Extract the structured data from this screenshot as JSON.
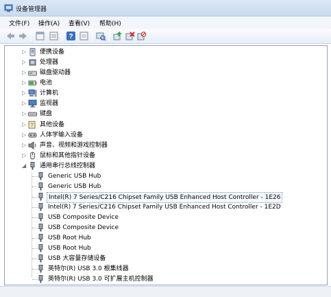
{
  "window": {
    "title": "设备管理器"
  },
  "menu": [
    {
      "label": "文件(F)"
    },
    {
      "label": "操作(A)"
    },
    {
      "label": "查看(V)"
    },
    {
      "label": "帮助(H)"
    }
  ],
  "toolbar": {
    "buttons": [
      {
        "icon": "back-arrow-icon"
      },
      {
        "icon": "forward-arrow-icon"
      },
      {
        "icon": "properties-icon"
      },
      {
        "icon": "show-hide-icon"
      },
      {
        "icon": "help-icon"
      },
      {
        "icon": "console-icon"
      },
      {
        "icon": "scan-hardware-icon"
      },
      {
        "icon": "update-driver-icon"
      },
      {
        "icon": "uninstall-icon"
      },
      {
        "icon": "disable-icon"
      }
    ]
  },
  "tree": {
    "categories": [
      {
        "label": "便携设备",
        "icon": "portable-device-icon",
        "expanded": false
      },
      {
        "label": "处理器",
        "icon": "processor-icon",
        "expanded": false
      },
      {
        "label": "磁盘驱动器",
        "icon": "disk-drive-icon",
        "expanded": false
      },
      {
        "label": "电池",
        "icon": "battery-icon",
        "expanded": false
      },
      {
        "label": "计算机",
        "icon": "computer-icon",
        "expanded": false
      },
      {
        "label": "监视器",
        "icon": "monitor-icon",
        "expanded": false
      },
      {
        "label": "键盘",
        "icon": "keyboard-icon",
        "expanded": false
      },
      {
        "label": "其他设备",
        "icon": "other-devices-icon",
        "expanded": false
      },
      {
        "label": "人体学输入设备",
        "icon": "hid-icon",
        "expanded": false
      },
      {
        "label": "声音、视频和游戏控制器",
        "icon": "sound-icon",
        "expanded": false
      },
      {
        "label": "鼠标和其他指针设备",
        "icon": "mouse-icon",
        "expanded": false
      },
      {
        "label": "通用串行总线控制器",
        "icon": "usb-controller-icon",
        "expanded": true
      }
    ],
    "usb_children": [
      {
        "label": "Generic USB Hub"
      },
      {
        "label": "Generic USB Hub"
      },
      {
        "label": "Intel(R) 7 Series/C216 Chipset Family USB Enhanced Host Controller - 1E26",
        "selected": true
      },
      {
        "label": "Intel(R) 7 Series/C216 Chipset Family USB Enhanced Host Controller - 1E2D"
      },
      {
        "label": "USB Composite Device"
      },
      {
        "label": "USB Composite Device"
      },
      {
        "label": "USB Root Hub"
      },
      {
        "label": "USB Root Hub"
      },
      {
        "label": "USB 大容量存储设备"
      },
      {
        "label": "英特尔(R) USB 3.0 根集线器"
      },
      {
        "label": "英特尔(R) USB 3.0 可扩展主机控制器"
      }
    ]
  }
}
